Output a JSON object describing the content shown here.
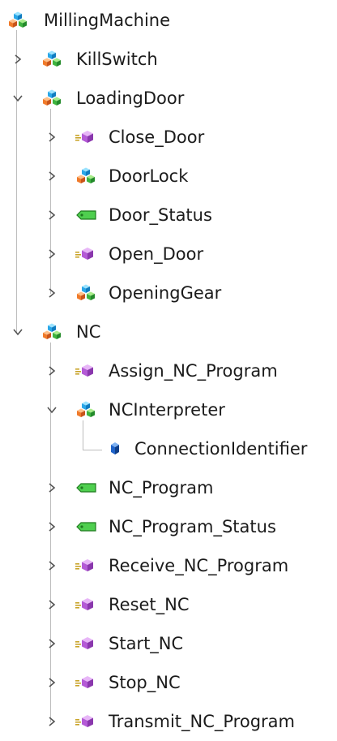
{
  "tree": {
    "root": {
      "label": "MillingMachine",
      "icon": "object-icon"
    },
    "kill_switch": {
      "label": "KillSwitch",
      "icon": "object-icon"
    },
    "loading_door": {
      "label": "LoadingDoor",
      "icon": "object-icon",
      "children": {
        "close_door": {
          "label": "Close_Door",
          "icon": "method-icon"
        },
        "door_lock": {
          "label": "DoorLock",
          "icon": "object-icon"
        },
        "door_status": {
          "label": "Door_Status",
          "icon": "variable-icon"
        },
        "open_door": {
          "label": "Open_Door",
          "icon": "method-icon"
        },
        "opening_gear": {
          "label": "OpeningGear",
          "icon": "object-icon"
        }
      }
    },
    "nc": {
      "label": "NC",
      "icon": "object-icon",
      "children": {
        "assign_nc_program": {
          "label": "Assign_NC_Program",
          "icon": "method-icon"
        },
        "nc_interpreter": {
          "label": "NCInterpreter",
          "icon": "object-icon",
          "children": {
            "connection_identifier": {
              "label": "ConnectionIdentifier",
              "icon": "property-icon"
            }
          }
        },
        "nc_program": {
          "label": "NC_Program",
          "icon": "variable-icon"
        },
        "nc_program_status": {
          "label": "NC_Program_Status",
          "icon": "variable-icon"
        },
        "receive_nc_program": {
          "label": "Receive_NC_Program",
          "icon": "method-icon"
        },
        "reset_nc": {
          "label": "Reset_NC",
          "icon": "method-icon"
        },
        "start_nc": {
          "label": "Start_NC",
          "icon": "method-icon"
        },
        "stop_nc": {
          "label": "Stop_NC",
          "icon": "method-icon"
        },
        "transmit_nc_program": {
          "label": "Transmit_NC_Program",
          "icon": "method-icon"
        }
      }
    }
  },
  "colors": {
    "cube_blue": "#2aa7e8",
    "cube_orange": "#f07a2a",
    "cube_green": "#3fb43f",
    "method_purple": "#b45ad6",
    "variable_green": "#4fcf4f",
    "property_blue": "#1f63c9",
    "guide_line": "#bdbdbd"
  }
}
